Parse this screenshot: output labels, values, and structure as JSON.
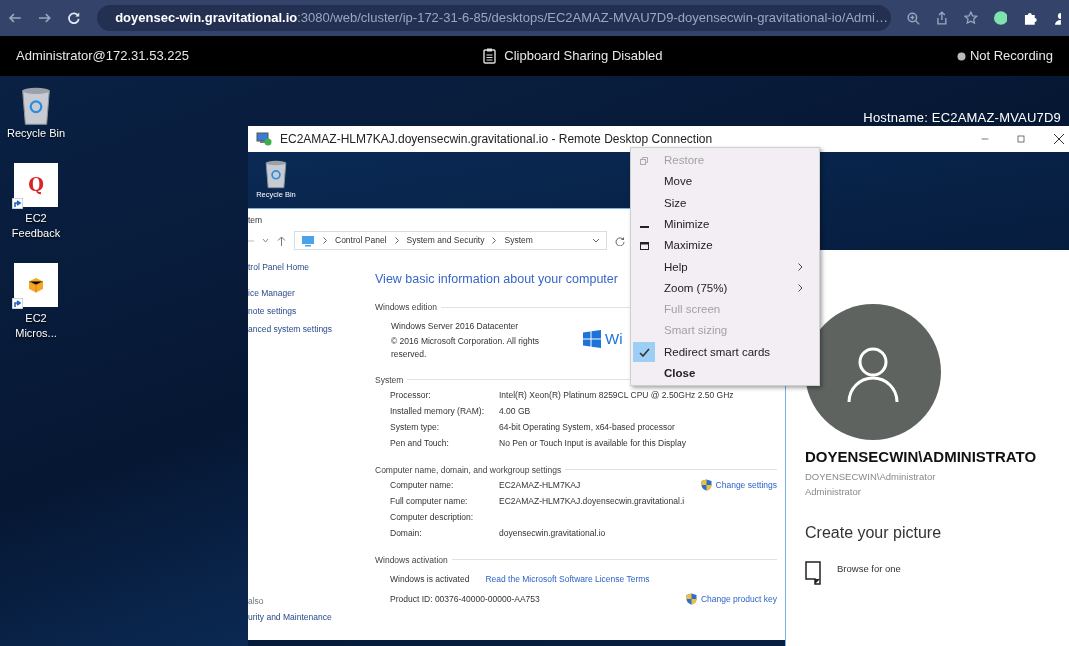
{
  "browser": {
    "url": "**doyensec-win.gravitational.io**:3080/web/cluster/ip-172-31-6-85/desktops/EC2AMAZ-MVAU7D9-doyensecwin-gravitational-io/Admi…"
  },
  "session_bar": {
    "user": "Administrator@172.31.53.225",
    "clipboard": "Clipboard Sharing Disabled",
    "recording": "Not Recording"
  },
  "desktop": {
    "hostname": "Hostname: EC2AMAZ-MVAU7D9",
    "icons": [
      {
        "kind": "recycle-bin",
        "label": "Recycle Bin"
      },
      {
        "kind": "feedback",
        "glyph": "Q",
        "label": "EC2 Feedback"
      },
      {
        "kind": "package",
        "label": "EC2 Micros..."
      }
    ]
  },
  "rdc_window": {
    "title": "EC2AMAZ-HLM7KAJ.doyensecwin.gravitational.io - Remote Desktop Connection",
    "remote_icons": [
      {
        "label": "Recycle Bin"
      }
    ],
    "control_panel": {
      "title": "tem",
      "breadcrumb": [
        "Control Panel",
        "System and Security",
        "System"
      ],
      "sidebar": [
        "trol Panel Home",
        "ice Manager",
        "note settings",
        "anced system settings"
      ],
      "see_also": "also",
      "see_also_links": [
        "urity and Maintenance"
      ],
      "heading": "View basic information about your computer",
      "edition": {
        "title": "Windows edition",
        "name": "Windows Server 2016 Datacenter",
        "copyright": "© 2016 Microsoft Corporation. All rights reserved.",
        "logo_text": "Wi"
      },
      "system": {
        "title": "System",
        "rows": [
          {
            "label": "Processor:",
            "value": "Intel(R) Xeon(R) Platinum 8259CL CPU @ 2.50GHz   2.50 GHz"
          },
          {
            "label": "Installed memory (RAM):",
            "value": "4.00 GB"
          },
          {
            "label": "System type:",
            "value": "64-bit Operating System, x64-based processor"
          },
          {
            "label": "Pen and Touch:",
            "value": "No Pen or Touch Input is available for this Display"
          }
        ]
      },
      "computer": {
        "title": "Computer name, domain, and workgroup settings",
        "action": "Change settings",
        "rows": [
          {
            "label": "Computer name:",
            "value": "EC2AMAZ-HLM7KAJ"
          },
          {
            "label": "Full computer name:",
            "value": "EC2AMAZ-HLM7KAJ.doyensecwin.gravitational.i"
          },
          {
            "label": "Computer description:"
          },
          {
            "label": "Domain:",
            "value": "doyensecwin.gravitational.io"
          }
        ]
      },
      "activation": {
        "title": "Windows activation",
        "status": "Windows is activated",
        "link": "Read the Microsoft Software License Terms",
        "product_id": "Product ID: 00376-40000-00000-AA753",
        "action": "Change product key"
      }
    },
    "account": {
      "display_name": "DOYENSECWIN\\ADMINISTRATO",
      "account": "DOYENSECWIN\\Administrator",
      "role": "Administrator",
      "picture_heading": "Create your picture",
      "browse": "Browse for one"
    },
    "menu": {
      "items": [
        {
          "kind": "restore",
          "label": "Restore",
          "disabled": true,
          "checked": false,
          "submenu": false
        },
        {
          "kind": "plain",
          "label": "Move",
          "disabled": false,
          "checked": false,
          "submenu": false
        },
        {
          "kind": "plain",
          "label": "Size",
          "disabled": false,
          "checked": false,
          "submenu": false
        },
        {
          "kind": "minimize",
          "label": "Minimize",
          "disabled": false,
          "checked": false,
          "submenu": false
        },
        {
          "kind": "maximize",
          "label": "Maximize",
          "disabled": false,
          "checked": false,
          "submenu": false
        },
        {
          "kind": "plain",
          "label": "Help",
          "disabled": false,
          "checked": false,
          "submenu": true
        },
        {
          "kind": "plain",
          "label": "Zoom (75%)",
          "disabled": false,
          "checked": false,
          "submenu": true
        },
        {
          "kind": "plain",
          "label": "Full screen",
          "disabled": true,
          "checked": false,
          "submenu": false
        },
        {
          "kind": "plain",
          "label": "Smart sizing",
          "disabled": true,
          "checked": false,
          "submenu": false
        },
        {
          "kind": "plain",
          "label": "Redirect smart cards",
          "disabled": false,
          "checked": true,
          "submenu": false
        },
        {
          "kind": "default",
          "label": "Close",
          "disabled": false,
          "checked": false,
          "submenu": false
        }
      ]
    }
  }
}
